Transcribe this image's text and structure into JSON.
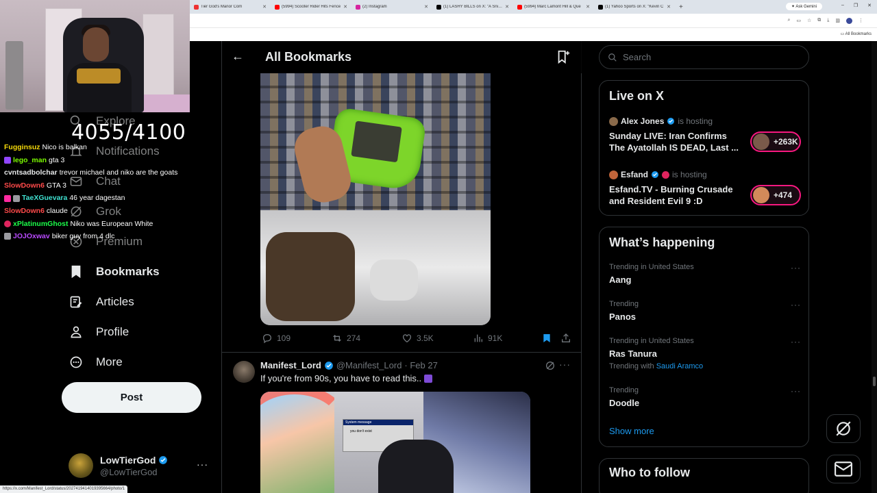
{
  "browser": {
    "tabs": [
      {
        "label": "Tier God's Manor Com",
        "icon": "web-icon"
      },
      {
        "label": "(5994) Scooter Rider Hits Fence",
        "icon": "youtube-icon"
      },
      {
        "label": "(2) Instagram",
        "icon": "instagram-icon"
      },
      {
        "label": "(1) LASHY BILLS on X: \"A Sniper",
        "icon": "x-icon"
      },
      {
        "label": "(5994) Marc Lamont Hill & Que",
        "icon": "youtube-icon"
      },
      {
        "label": "(1) Yahoo Sports on X: \"Kevin C",
        "icon": "x-icon"
      }
    ],
    "new_tab": "+",
    "ask_gemini": "Ask Gemini",
    "all_bookmarks": "All Bookmarks",
    "status_url": "https://x.com/Manifest_Lord/status/2027419414019395664/photo/1"
  },
  "stream": {
    "counter": "4055/4100",
    "chat": [
      {
        "user": "Fugginsuz",
        "msg": "Nico is balkan",
        "color": "#f5d90a"
      },
      {
        "user": "lego_man",
        "msg": "gta 3",
        "color": "#7cfc00"
      },
      {
        "user": "cvntsadbolchar",
        "msg": "trevor michael and niko are the goats",
        "color": "#e7e9ea"
      },
      {
        "user": "SlowDown6",
        "msg": "GTA 3",
        "color": "#ff4a4a"
      },
      {
        "user": "TaeXGuevara",
        "msg": "46 year dagestan",
        "color": "#3fe0d0"
      },
      {
        "user": "SlowDown6",
        "msg": "claude",
        "color": "#ff4a4a"
      },
      {
        "user": "xPlatinumGhost",
        "msg": "Niko was European White",
        "color": "#1cff4a"
      },
      {
        "user": "JOJOxwav",
        "msg": "biker guy from 4 dlc",
        "color": "#b94aff"
      }
    ]
  },
  "nav": {
    "items": [
      {
        "label": "Explore",
        "icon": "search-icon"
      },
      {
        "label": "Notifications",
        "icon": "bell-icon"
      },
      {
        "label": "Chat",
        "icon": "mail-icon"
      },
      {
        "label": "Grok",
        "icon": "grok-icon"
      },
      {
        "label": "Premium",
        "icon": "x-logo-icon"
      },
      {
        "label": "Bookmarks",
        "icon": "bookmark-icon"
      },
      {
        "label": "Articles",
        "icon": "article-icon"
      },
      {
        "label": "Profile",
        "icon": "person-icon"
      },
      {
        "label": "More",
        "icon": "more-circle-icon"
      }
    ],
    "post_label": "Post",
    "account": {
      "name": "LowTierGod",
      "handle": "@LowTierGod",
      "more": "···"
    }
  },
  "main": {
    "title": "All Bookmarks",
    "tweet1_actions": {
      "replies": "109",
      "reposts": "274",
      "likes": "3.5K",
      "views": "91K"
    },
    "tweet2": {
      "name": "Manifest_Lord",
      "handle": "@Manifest_Lord",
      "date": "· Feb 27",
      "text": "If you're from 90s, you have to read this..",
      "dialog_title": "System message",
      "dialog_text": "you don't exist"
    }
  },
  "sidebar": {
    "search_placeholder": "Search",
    "live": {
      "title": "Live on X",
      "items": [
        {
          "host": "Alex Jones",
          "suffix": "is hosting",
          "title": "Sunday LIVE: Iran Confirms The Ayatollah IS DEAD, Last ...",
          "count": "+263K"
        },
        {
          "host": "Esfand",
          "suffix": "is hosting",
          "title": "Esfand.TV - Burning Crusade and Resident Evil 9 :D",
          "count": "+474"
        }
      ]
    },
    "happening": {
      "title": "What’s happening",
      "trends": [
        {
          "context": "Trending in United States",
          "name": "Aang"
        },
        {
          "context": "Trending",
          "name": "Panos"
        },
        {
          "context": "Trending in United States",
          "name": "Ras Tanura",
          "with_label": "Trending with",
          "with_link": "Saudi Aramco"
        },
        {
          "context": "Trending",
          "name": "Doodle"
        }
      ],
      "show_more": "Show more"
    },
    "who_to_follow": "Who to follow"
  },
  "colors": {
    "accent": "#1d9bf0",
    "live": "#f91880",
    "background": "#000000"
  }
}
